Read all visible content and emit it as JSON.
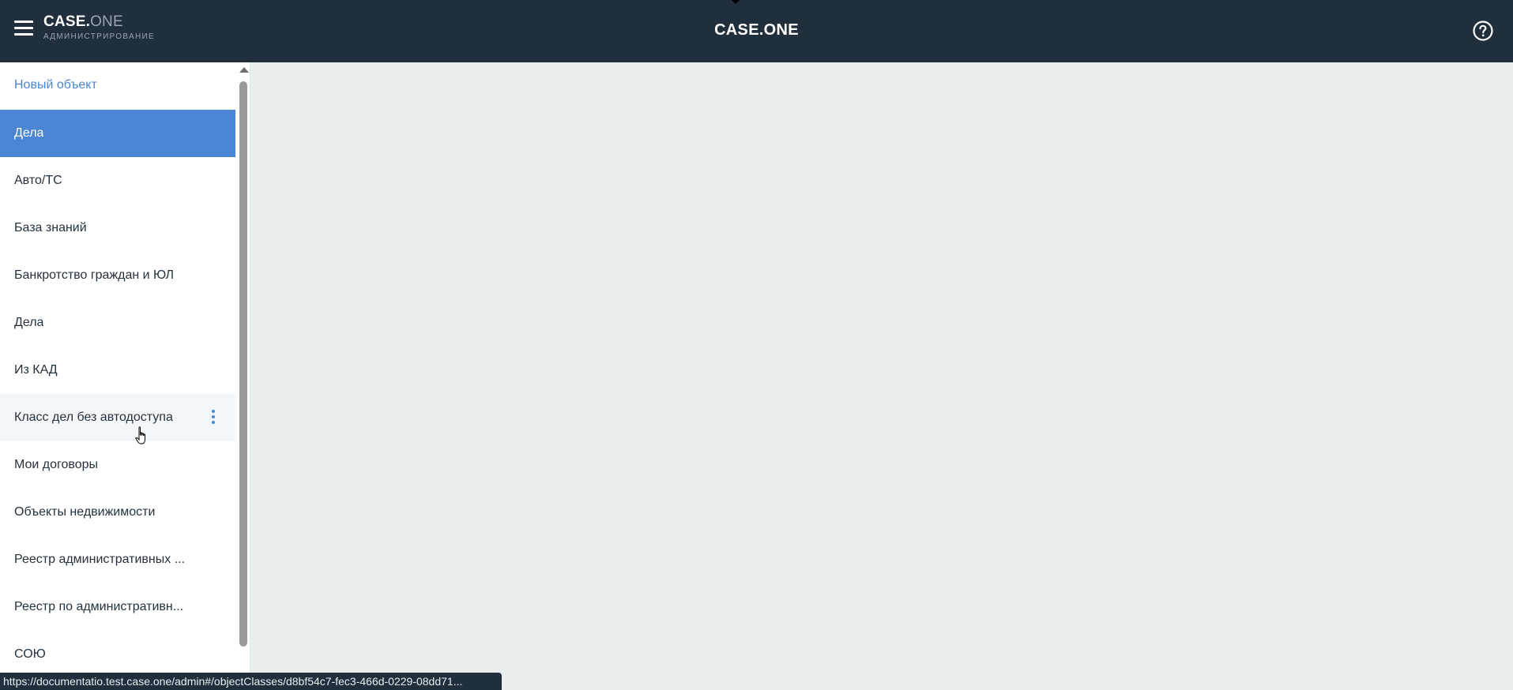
{
  "header": {
    "brand_main": "CASE.",
    "brand_accent": "ONE",
    "brand_sub": "АДМИНИСТРИРОВАНИЕ",
    "title": "CASE.ONE",
    "menu_icon": "hamburger-menu-icon",
    "help_icon": "help-circle-icon"
  },
  "sidebar": {
    "new_object": "Новый объект",
    "items": [
      {
        "label": "Дела"
      },
      {
        "label": "Авто/ТС"
      },
      {
        "label": "База знаний"
      },
      {
        "label": "Банкротство граждан и ЮЛ"
      },
      {
        "label": "Дела"
      },
      {
        "label": "Из КАД"
      },
      {
        "label": "Класс дел без автодоступа"
      },
      {
        "label": "Мои договоры"
      },
      {
        "label": "Объекты недвижимости"
      },
      {
        "label": "Реестр административных ..."
      },
      {
        "label": "Реестр по административн..."
      },
      {
        "label": "СОЮ"
      }
    ],
    "active_index": 0,
    "hover_index": 6
  },
  "status_bar": {
    "url": "https://documentatio.test.case.one/admin#/objectClasses/d8bf54c7-fec3-466d-0229-08dd71..."
  },
  "colors": {
    "topbar": "#212f3c",
    "accent": "#4a86d4",
    "content_bg": "#e9efef"
  }
}
